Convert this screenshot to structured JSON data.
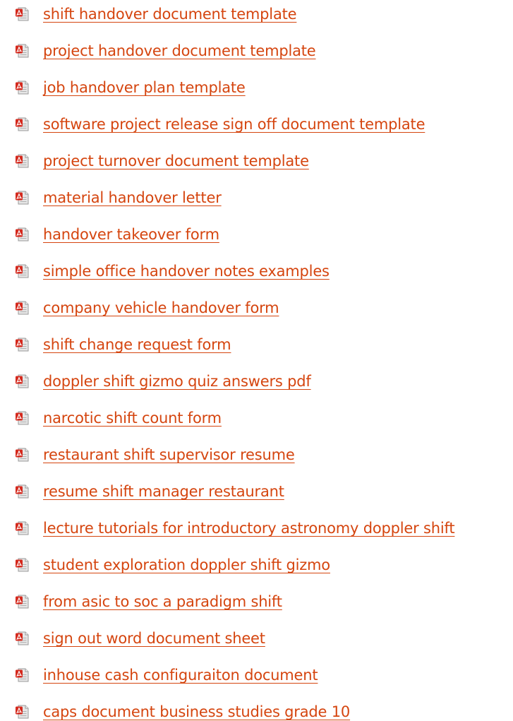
{
  "colors": {
    "link": "#d5450f",
    "icon_red": "#d42a1e",
    "icon_page": "#e6e6e6"
  },
  "icon": "pdf-file-icon",
  "links": [
    {
      "label": "shift handover document template"
    },
    {
      "label": "project handover document template"
    },
    {
      "label": "job handover plan template"
    },
    {
      "label": "software project release sign off document template"
    },
    {
      "label": "project turnover document template"
    },
    {
      "label": "material handover letter"
    },
    {
      "label": "handover takeover form"
    },
    {
      "label": "simple office handover notes examples"
    },
    {
      "label": "company vehicle handover form"
    },
    {
      "label": "shift change request form"
    },
    {
      "label": "doppler shift gizmo quiz answers pdf"
    },
    {
      "label": "narcotic shift count form"
    },
    {
      "label": "restaurant shift supervisor resume"
    },
    {
      "label": "resume shift manager restaurant"
    },
    {
      "label": "lecture tutorials for introductory astronomy doppler shift"
    },
    {
      "label": "student exploration doppler shift gizmo"
    },
    {
      "label": "from asic to soc a paradigm shift"
    },
    {
      "label": "sign out word document sheet"
    },
    {
      "label": "inhouse cash configuraiton document"
    },
    {
      "label": "caps document business studies grade 10"
    }
  ]
}
